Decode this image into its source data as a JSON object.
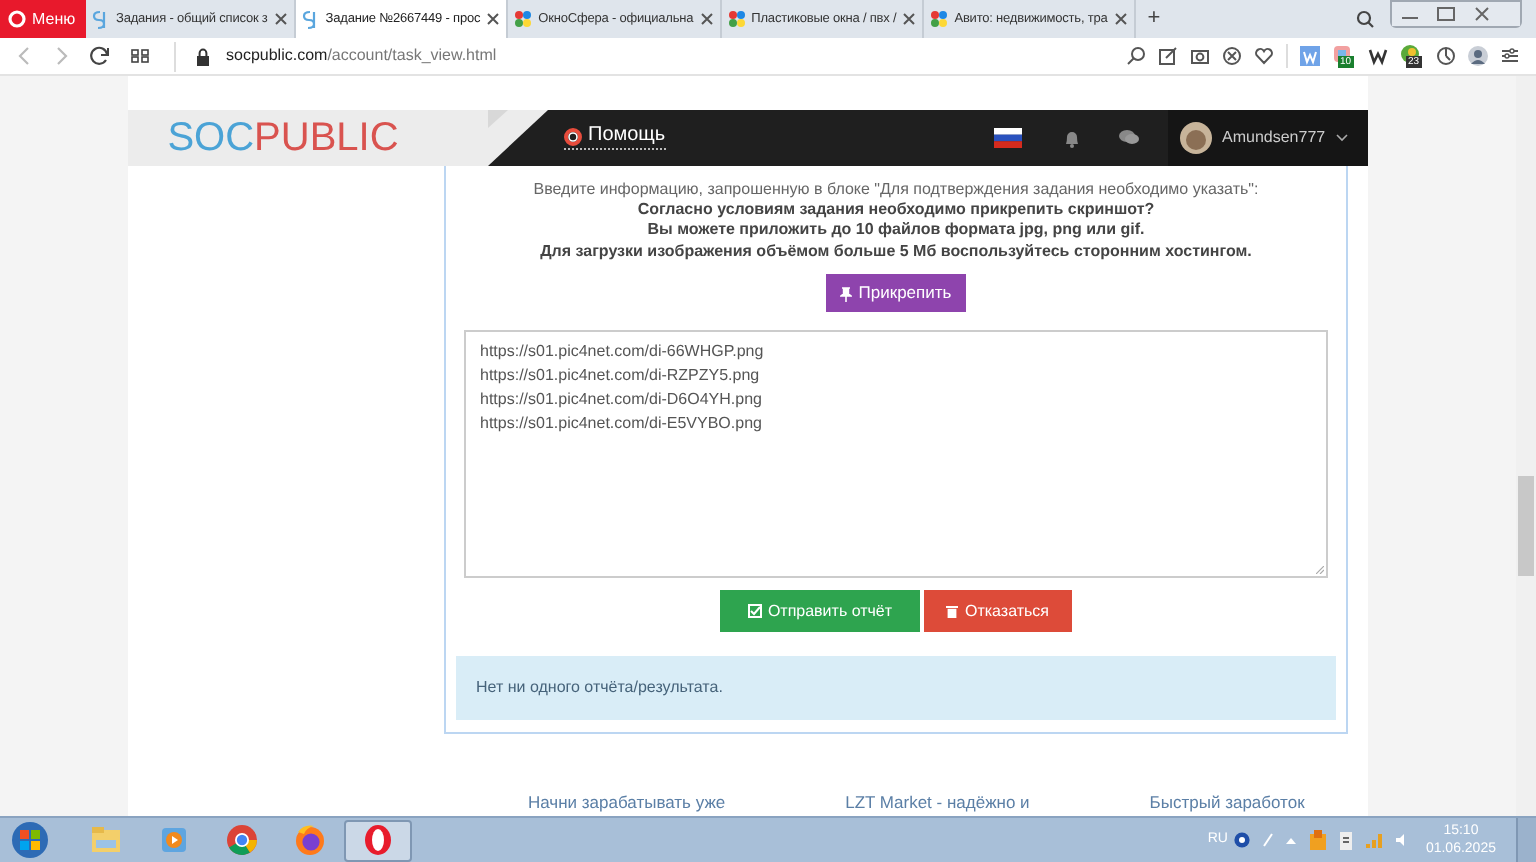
{
  "browser": {
    "menu_label": "Меню",
    "tabs": [
      {
        "title": "Задания - общий список з",
        "selected": false,
        "kind": "sp"
      },
      {
        "title": "Задание №2667449 - прос",
        "selected": true,
        "kind": "sp"
      },
      {
        "title": "ОкноСфера - официальна",
        "selected": false,
        "kind": "dots"
      },
      {
        "title": "Пластиковые окна / пвх /",
        "selected": false,
        "kind": "dots"
      },
      {
        "title": "Авито: недвижимость, тра",
        "selected": false,
        "kind": "dots"
      }
    ],
    "new_tab": "+",
    "address": {
      "domain": "socpublic.com",
      "path": "/account/task_view.html"
    },
    "extension_badges": [
      "10",
      "23"
    ]
  },
  "site_header": {
    "logo": {
      "accent_part": "SOC",
      "main_part": "PUBLIC"
    },
    "help_link": "Помощь",
    "username": "Amundsen777"
  },
  "task_card": {
    "intro": "Введите информацию, запрошенную в блоке \"Для подтверждения задания необходимо указать\":",
    "notes": [
      "Согласно условиям задания необходимо прикрепить скриншот?",
      "Вы можете приложить до 10 файлов формата jpg, png или gif.",
      "Для загрузки изображения объёмом больше 5 Мб воспользуйтесь сторонним хостингом."
    ],
    "attach_button": "Прикрепить",
    "answer_lines": [
      "https://s01.pic4net.com/di-66WHGP.png",
      "https://s01.pic4net.com/di-RZPZY5.png",
      "https://s01.pic4net.com/di-D6O4YH.png",
      "https://s01.pic4net.com/di-E5VYBO.png"
    ],
    "buttons": [
      {
        "label": "Отправить отчёт",
        "kind": "submit"
      },
      {
        "label": "Отказаться",
        "kind": "refuse"
      }
    ],
    "info_message": "Нет ни одного отчёта/результата."
  },
  "footer_links": [
    "Начни зарабатывать уже",
    "LZT Market - надёжно и",
    "Быстрый заработок"
  ],
  "taskbar": {
    "apps": [
      {
        "kind": "folder",
        "selected": false
      },
      {
        "kind": "media",
        "selected": false
      },
      {
        "kind": "chrome",
        "selected": false
      },
      {
        "kind": "firefox",
        "selected": false
      },
      {
        "kind": "opera",
        "selected": true
      }
    ],
    "language": "RU",
    "time": "15:10",
    "date": "01.06.2025"
  }
}
